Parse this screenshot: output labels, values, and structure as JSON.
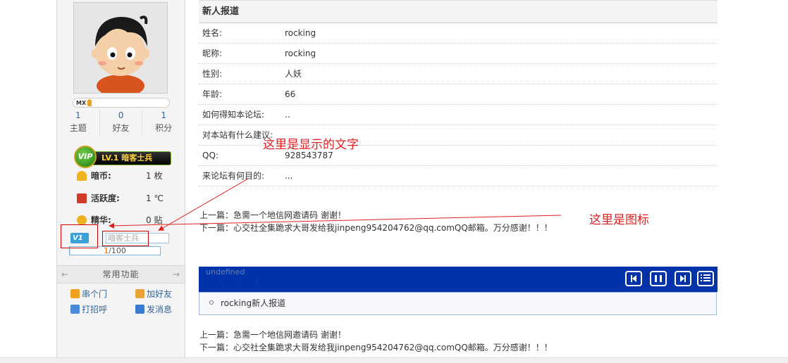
{
  "sidebar": {
    "medal": "MX",
    "stats": [
      {
        "num": "1",
        "label": "主题"
      },
      {
        "num": "0",
        "label": "好友"
      },
      {
        "num": "1",
        "label": "积分"
      }
    ],
    "vip": {
      "badge": "VIP",
      "level_text": "LV.1 暗客士兵"
    },
    "profile": [
      {
        "label": "暗币:",
        "value": "1 枚",
        "icon": "coin-icon"
      },
      {
        "label": "活跃度:",
        "value": "1 ℃",
        "icon": "activity-icon"
      },
      {
        "label": "精华:",
        "value": "0 贴",
        "icon": "essence-icon"
      }
    ],
    "level_icon": "V1",
    "level_title": "暗客士兵",
    "progress": {
      "current": "1",
      "total": "100",
      "fraction": 0.01
    },
    "common_header": "常用功能",
    "functions": [
      {
        "label": "串个门",
        "icon": "home-icon",
        "color": "#f0a020"
      },
      {
        "label": "加好友",
        "icon": "add-friend-icon",
        "color": "#e8a43a"
      },
      {
        "label": "打招呼",
        "icon": "greet-icon",
        "color": "#4a8ad8"
      },
      {
        "label": "发消息",
        "icon": "message-icon",
        "color": "#3a7ad0"
      }
    ]
  },
  "thread": {
    "title": "新人报道",
    "fields": [
      {
        "label": "姓名:",
        "value": "rocking"
      },
      {
        "label": "昵称:",
        "value": "rocking"
      },
      {
        "label": "性别:",
        "value": "人妖"
      },
      {
        "label": "年龄:",
        "value": "66"
      },
      {
        "label": "如何得知本论坛:",
        "value": ".."
      },
      {
        "label": "对本站有什么建议:",
        "value": ""
      },
      {
        "label": "QQ:",
        "value": "928543787"
      },
      {
        "label": "来论坛有何目的:",
        "value": "..."
      }
    ],
    "prev": "上一篇：急需一个地信网邀请码 谢谢！",
    "next": "下一篇：心交社全集跪求大哥发给我jinpeng954204762@qq.comQQ邮箱。万分感谢！！！"
  },
  "player": {
    "undefined_text": "undefined",
    "dots": "· · ·",
    "playlist_item": "rocking新人报道"
  },
  "annotations": {
    "text_note": "这里是显示的文字",
    "icon_note": "这里是图标"
  },
  "colors": {
    "accent_red": "#e02020",
    "player_blue": "#0033aa",
    "link_blue": "#336699"
  }
}
